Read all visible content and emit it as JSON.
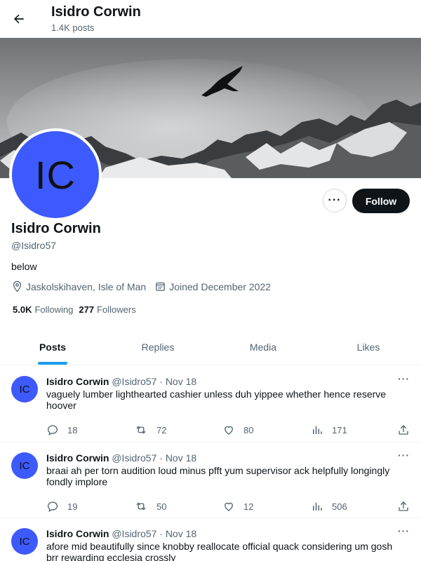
{
  "header": {
    "title": "Isidro Corwin",
    "subtitle": "1.4K posts"
  },
  "profile": {
    "avatar_initials": "IC",
    "name": "Isidro Corwin",
    "handle": "@Isidro57",
    "bio": "below",
    "location": "Jaskolskihaven, Isle of Man",
    "joined": "Joined December 2022",
    "following_count": "5.0K",
    "following_label": "Following",
    "followers_count": "277",
    "followers_label": "Followers",
    "follow_label": "Follow",
    "more_label": "···"
  },
  "tabs": [
    {
      "label": "Posts",
      "active": true
    },
    {
      "label": "Replies"
    },
    {
      "label": "Media"
    },
    {
      "label": "Likes"
    }
  ],
  "tweets": [
    {
      "avatar": "IC",
      "name": "Isidro Corwin",
      "handle": "@Isidro57",
      "date": "· Nov 18",
      "text": "vaguely lumber lighthearted cashier unless duh yippee whether hence reserve hoover",
      "replies": "18",
      "retweets": "72",
      "likes": "80",
      "views": "171"
    },
    {
      "avatar": "IC",
      "name": "Isidro Corwin",
      "handle": "@Isidro57",
      "date": "· Nov 18",
      "text": "braai ah per torn audition loud minus pfft yum supervisor ack helpfully longingly fondly implore",
      "replies": "19",
      "retweets": "50",
      "likes": "12",
      "views": "506"
    },
    {
      "avatar": "IC",
      "name": "Isidro Corwin",
      "handle": "@Isidro57",
      "date": "· Nov 18",
      "text": "afore mid beautifully since knobby reallocate official quack considering um gosh brr rewarding ecclesia crossly",
      "replies": "",
      "retweets": "",
      "likes": "",
      "views": ""
    }
  ],
  "tweet_more_label": "···",
  "colors": {
    "accent": "#1d9bf0",
    "avatar_bg": "#3d5afe",
    "follow_bg": "#0f1419"
  }
}
